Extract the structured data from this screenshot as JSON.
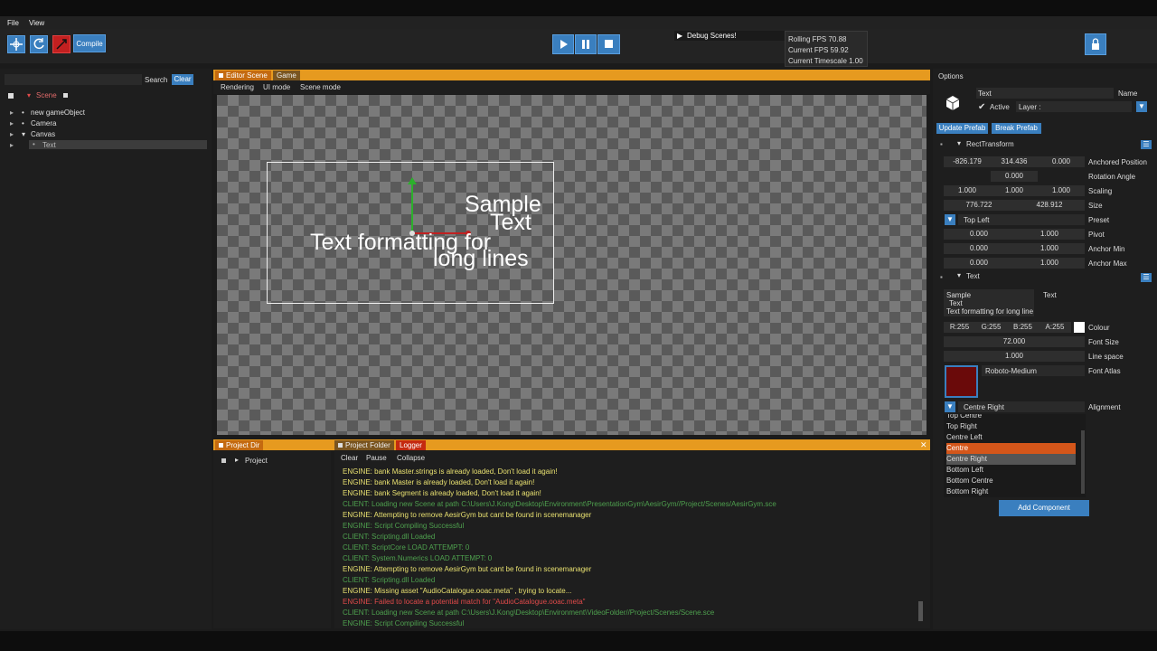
{
  "menu": {
    "file": "File",
    "view": "View"
  },
  "toolbar": {
    "compile": "Compile",
    "debug_scenes": "Debug Scenes!"
  },
  "stats": {
    "rolling_fps": "Rolling  FPS 70.88",
    "current_fps": "Current FPS 59.92",
    "timescale": "Current Timescale 1.00"
  },
  "hierarchy": {
    "search_label": "Search",
    "clear_label": "Clear",
    "root": "Scene",
    "items": [
      "new gameObject",
      "Camera",
      "Canvas",
      "Text"
    ]
  },
  "editor": {
    "tab_editor": "Editor Scene",
    "tab_game": "Game",
    "sub_rendering": "Rendering",
    "sub_ui": "UI mode",
    "sub_scene": "Scene mode",
    "sample_line1": "Sample",
    "sample_line2": "Text",
    "sample_line3": "Text formatting for",
    "sample_line4": "long lines"
  },
  "bottom": {
    "tab_project_dir": "Project Dir",
    "tab_project_folder": "Project Folder",
    "tab_logger": "Logger",
    "project_item": "Project",
    "clear": "Clear",
    "pause": "Pause",
    "collapse": "Collapse",
    "close": "✕",
    "logs": [
      {
        "text": "ENGINE: bank Master.strings is already loaded, Don't load it again!",
        "c": "ly"
      },
      {
        "text": "ENGINE: bank Master is already loaded, Don't load it again!",
        "c": "ly"
      },
      {
        "text": "ENGINE: bank Segment is already loaded, Don't load it again!",
        "c": "ly"
      },
      {
        "text": "CLIENT: Loading new Scene at path C:\\Users\\J.Kong\\Desktop\\Environment\\PresentationGym\\AesirGym//Project/Scenes/AesirGym.sce",
        "c": "lg"
      },
      {
        "text": "ENGINE: Attempting to remove AesirGym but cant be found in scenemanager",
        "c": "ly"
      },
      {
        "text": "ENGINE: Script Compiling Successful",
        "c": "lg"
      },
      {
        "text": "CLIENT: Scripting.dll Loaded",
        "c": "lg"
      },
      {
        "text": "CLIENT: ScriptCore LOAD ATTEMPT: 0",
        "c": "lg"
      },
      {
        "text": "CLIENT: System.Numerics LOAD ATTEMPT: 0",
        "c": "lg"
      },
      {
        "text": "ENGINE: Attempting to remove AesirGym but cant be found in scenemanager",
        "c": "ly"
      },
      {
        "text": "CLIENT: Scripting.dll Loaded",
        "c": "lg"
      },
      {
        "text": "ENGINE: Missing asset \"AudioCatalogue.ooac.meta\" , trying to locate...",
        "c": "ly"
      },
      {
        "text": "ENGINE: Failed to locate a potential match for \"AudioCatalogue.ooac.meta\"",
        "c": "lr"
      },
      {
        "text": "CLIENT: Loading new Scene at path C:\\Users\\J.Kong\\Desktop\\Environment\\VideoFolder//Project/Scenes/Scene.sce",
        "c": "lg"
      },
      {
        "text": "ENGINE: Script Compiling Successful",
        "c": "lg"
      }
    ]
  },
  "inspector": {
    "options": "Options",
    "name_value": "Text",
    "name_label": "Name",
    "active": "Active",
    "layer": "Layer :",
    "update_prefab": "Update Prefab",
    "break_prefab": "Break Prefab",
    "rect_transform": "RectTransform",
    "anchored_pos": [
      "-826.179",
      "314.436",
      "0.000"
    ],
    "anchored_pos_label": "Anchored Position",
    "rotation": "0.000",
    "rotation_label": "Rotation Angle",
    "scaling": [
      "1.000",
      "1.000",
      "1.000"
    ],
    "scaling_label": "Scaling",
    "size": [
      "776.722",
      "428.912"
    ],
    "size_label": "Size",
    "preset_value": "Top Left",
    "preset_label": "Preset",
    "pivot": [
      "0.000",
      "1.000"
    ],
    "pivot_label": "Pivot",
    "anchor_min": [
      "0.000",
      "1.000"
    ],
    "anchor_min_label": "Anchor Min",
    "anchor_max": [
      "0.000",
      "1.000"
    ],
    "anchor_max_label": "Anchor Max",
    "text_section": "Text",
    "text_value_1": "Sample",
    "text_value_2": "Text",
    "text_value_3": "Text formatting for long line",
    "text_label": "Text",
    "r": "R:255",
    "g": "G:255",
    "b": "B:255",
    "a": "A:255",
    "colour_label": "Colour",
    "font_size": "72.000",
    "font_size_label": "Font Size",
    "line_space": "1.000",
    "line_space_label": "Line space",
    "font_atlas": "Roboto-Medium",
    "font_atlas_label": "Font Atlas",
    "alignment_value": "Centre Right",
    "alignment_label": "Alignment",
    "alignment_options": [
      "Top Centre",
      "Top Right",
      "Centre Left",
      "Centre",
      "Centre Right",
      "Bottom Left",
      "Bottom Centre",
      "Bottom Right"
    ],
    "add_component": "Add Component"
  },
  "colors": {
    "accent_orange": "#e69a1f",
    "accent_blue": "#3a7fbf",
    "highlight": "#d4561a"
  }
}
